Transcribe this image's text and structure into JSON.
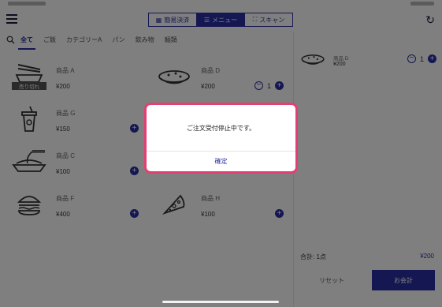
{
  "toolbar": {
    "segments": [
      {
        "label": "簡易決済",
        "icon": "calculator-icon"
      },
      {
        "label": "メニュー",
        "icon": "list-icon"
      },
      {
        "label": "スキャン",
        "icon": "scan-icon"
      }
    ]
  },
  "categories": [
    "全て",
    "ご飯",
    "カテゴリーA",
    "パン",
    "飲み物",
    "麺類"
  ],
  "products": [
    {
      "name": "商品 A",
      "price": "¥200",
      "badge": "売り切れ"
    },
    {
      "name": "商品 D",
      "price": "¥200",
      "qty": "1"
    },
    {
      "name": "商品 G",
      "price": "¥150"
    },
    {
      "name": "商品 C",
      "price": "¥100"
    },
    {
      "name": "商品 F",
      "price": "¥400"
    },
    {
      "name": "商品 H",
      "price": "¥100"
    }
  ],
  "cart": {
    "item": {
      "name": "商品 D",
      "price": "¥200",
      "qty": "1"
    },
    "total_label": "合計: 1点",
    "total_amount": "¥200",
    "reset_label": "リセット",
    "checkout_label": "お会計"
  },
  "dialog": {
    "message": "ご注文受付停止中です。",
    "confirm_label": "確定"
  },
  "colors": {
    "accent": "#2b2fa5",
    "highlight": "#e23f73"
  }
}
